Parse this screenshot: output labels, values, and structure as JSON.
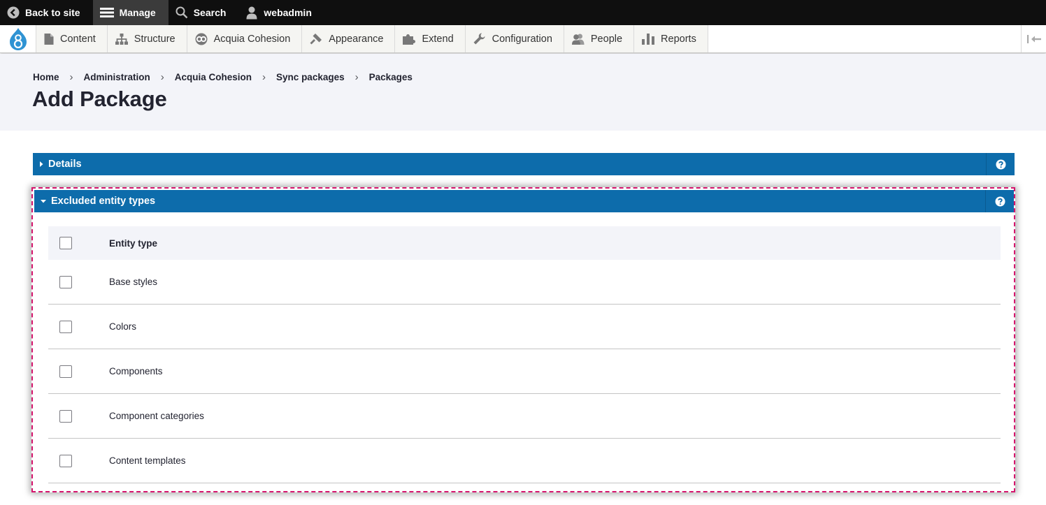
{
  "toolbar": {
    "back_to_site": "Back to site",
    "manage": "Manage",
    "search": "Search",
    "user": "webadmin"
  },
  "admin_menu": {
    "items": [
      {
        "label": "Content",
        "icon": "file-icon"
      },
      {
        "label": "Structure",
        "icon": "sitemap-icon"
      },
      {
        "label": "Acquia Cohesion",
        "icon": "cohesion-icon"
      },
      {
        "label": "Appearance",
        "icon": "paintbrush-icon"
      },
      {
        "label": "Extend",
        "icon": "puzzle-icon"
      },
      {
        "label": "Configuration",
        "icon": "wrench-icon"
      },
      {
        "label": "People",
        "icon": "people-icon"
      },
      {
        "label": "Reports",
        "icon": "bar-chart-icon"
      }
    ]
  },
  "breadcrumb": [
    "Home",
    "Administration",
    "Acquia Cohesion",
    "Sync packages",
    "Packages"
  ],
  "page_title": "Add Package",
  "details_panel": {
    "label": "Details",
    "expanded": false
  },
  "excluded_panel": {
    "label": "Excluded entity types",
    "expanded": true,
    "header": "Entity type",
    "rows": [
      "Base styles",
      "Colors",
      "Components",
      "Component categories",
      "Content templates"
    ]
  },
  "colors": {
    "accent": "#0d6cab",
    "highlight_border": "#d6156d",
    "toolbar_bg": "#0f0f0f"
  }
}
